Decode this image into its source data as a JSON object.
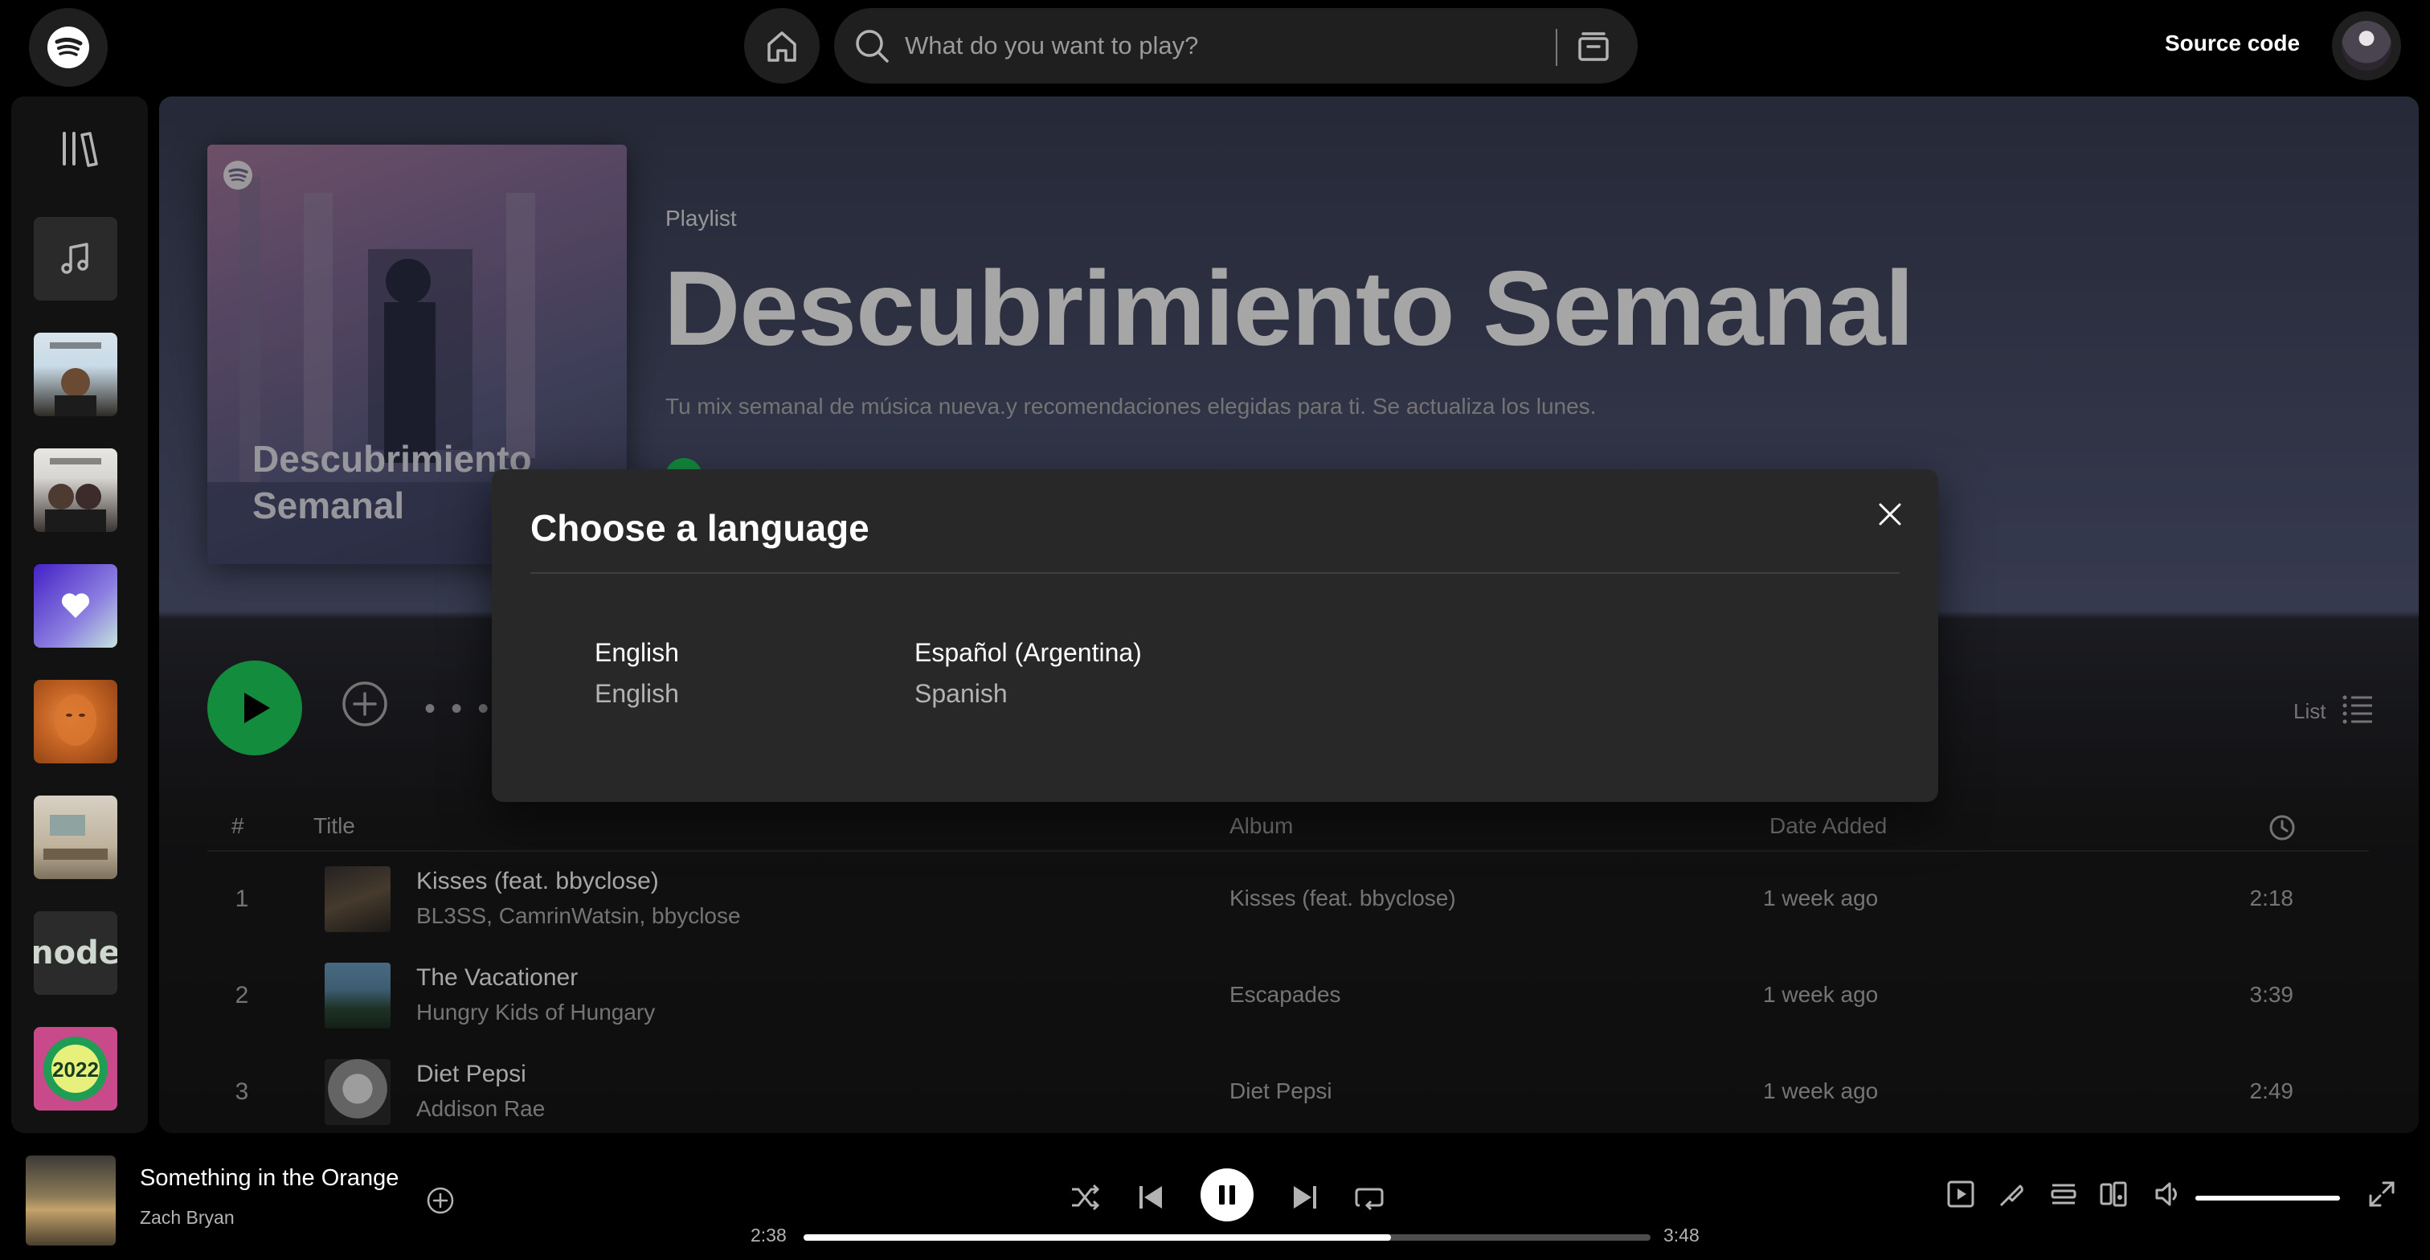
{
  "header": {
    "search_placeholder": "What do you want to play?",
    "source_code_label": "Source code",
    "icons": [
      "spotify-logo-icon",
      "home-icon",
      "search-icon",
      "browse-icon",
      "avatar"
    ]
  },
  "sidebar": {
    "items": [
      {
        "name": "library-icon"
      },
      {
        "name": "music-note-icon"
      },
      {
        "name": "this-is-rex-orange-county"
      },
      {
        "name": "this-is-twenty-one-pilots"
      },
      {
        "name": "liked-songs"
      },
      {
        "name": "orange-face-cover"
      },
      {
        "name": "room-cover"
      },
      {
        "name": "node-cover",
        "text": "node"
      },
      {
        "name": "top-2022-cover",
        "text": "2022"
      }
    ]
  },
  "playlist": {
    "type": "Playlist",
    "title": "Descubrimiento Semanal",
    "description": "Tu mix semanal de música nueva.y recomendaciones elegidas para ti. Se actualiza los lunes.",
    "cover_text_line1": "Descubrimiento",
    "cover_text_line2": "Semanal",
    "view_mode": "List"
  },
  "table": {
    "columns": [
      "#",
      "Title",
      "Album",
      "Date Added"
    ],
    "rows": [
      {
        "num": "1",
        "title": "Kisses (feat. bbyclose)",
        "artist": "BL3SS, CamrinWatsin, bbyclose",
        "album": "Kisses (feat. bbyclose)",
        "date": "1 week ago",
        "duration": "2:18"
      },
      {
        "num": "2",
        "title": "The Vacationer",
        "artist": "Hungry Kids of Hungary",
        "album": "Escapades",
        "date": "1 week ago",
        "duration": "3:39"
      },
      {
        "num": "3",
        "title": "Diet Pepsi",
        "artist": "Addison Rae",
        "album": "Diet Pepsi",
        "date": "1 week ago",
        "duration": "2:49"
      }
    ]
  },
  "modal": {
    "title": "Choose a language",
    "languages": [
      {
        "native": "English",
        "english": "English"
      },
      {
        "native": "Español (Argentina)",
        "english": "Spanish"
      }
    ]
  },
  "player": {
    "track": "Something in the Orange",
    "artist": "Zach Bryan",
    "elapsed": "2:38",
    "total": "3:48",
    "progress": 0.694,
    "volume": 1.0,
    "state": "playing"
  },
  "colors": {
    "accent": "#1ed760",
    "background": "#000000",
    "surface": "#121212",
    "modal": "#282828",
    "muted_text": "#b3b3b3"
  }
}
